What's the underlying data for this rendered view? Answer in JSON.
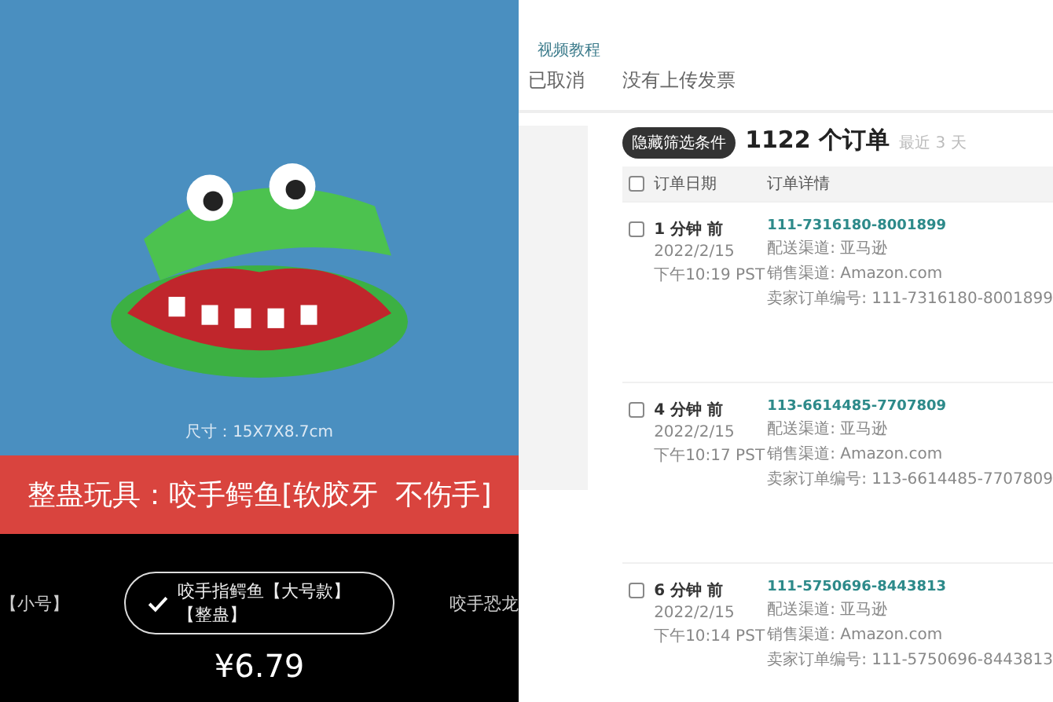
{
  "product_panel": {
    "size_caption": "尺寸：15X7X8.7cm",
    "title_banner": "整蛊玩具：咬手鳄鱼[软胶牙  不伤手]",
    "variants": [
      {
        "label": "【小号】",
        "selected": false
      },
      {
        "label": "咬手指鳄鱼【大号款】【整蛊】",
        "selected": true
      },
      {
        "label": "咬手恐龙",
        "selected": false
      }
    ],
    "price": "¥6.79"
  },
  "orders_panel": {
    "help_link": "视频教程",
    "tabs": [
      {
        "label": "已取消",
        "selected": false
      },
      {
        "label": "没有上传发票",
        "selected": false
      }
    ],
    "filter_button": "隐藏筛选条件",
    "order_count": "1122 个订单",
    "period": "最近 3 天",
    "table": {
      "select_all_checked": false,
      "columns": [
        "订单日期",
        "订单详情"
      ],
      "rows": [
        {
          "checked": false,
          "age": "1 分钟 前",
          "date": "2022/2/15",
          "time": "下午10:19 PST",
          "order_id": "111-7316180-8001899",
          "fulfillment": "配送渠道: 亚马逊",
          "sales_channel": "销售渠道: Amazon.com",
          "seller_order_id": "卖家订单编号: 111-7316180-8001899"
        },
        {
          "checked": false,
          "age": "4 分钟 前",
          "date": "2022/2/15",
          "time": "下午10:17 PST",
          "order_id": "113-6614485-7707809",
          "fulfillment": "配送渠道: 亚马逊",
          "sales_channel": "销售渠道: Amazon.com",
          "seller_order_id": "卖家订单编号: 113-6614485-7707809"
        },
        {
          "checked": false,
          "age": "6 分钟 前",
          "date": "2022/2/15",
          "time": "下午10:14 PST",
          "order_id": "111-5750696-8443813",
          "fulfillment": "配送渠道: 亚马逊",
          "sales_channel": "销售渠道: Amazon.com",
          "seller_order_id": "卖家订单编号: 111-5750696-8443813"
        }
      ]
    }
  }
}
